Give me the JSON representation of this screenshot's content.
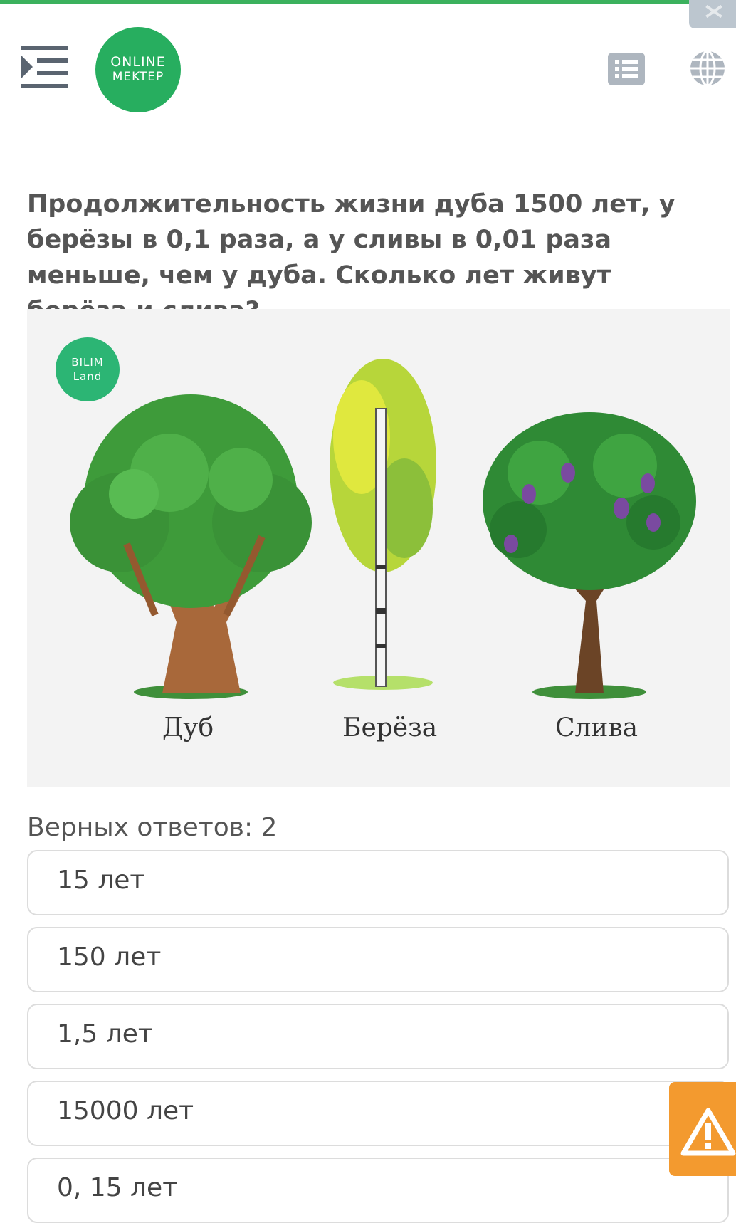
{
  "header": {
    "logo_line1": "ONLINE",
    "logo_line2": "MEKTEP"
  },
  "question": "Продолжительность жизни дуба 1500 лет, у берёзы в 0,1 раза, а у сливы в 0,01 раза меньше, чем у дуба. Сколько лет живут берёза и слива?",
  "picture": {
    "badge_line1": "BILIM",
    "badge_line2": "Land",
    "labels": [
      "Дуб",
      "Берёза",
      "Слива"
    ]
  },
  "answers_count": "Верных ответов: 2",
  "options": [
    "15 лет",
    "150 лет",
    "1,5 лет",
    "15000 лет",
    "0, 15 лет"
  ],
  "colors": {
    "accent": "#3bb15d",
    "logo": "#27ae5f",
    "warning": "#f39a2f"
  },
  "icons": [
    "menu-collapse-icon",
    "list-icon",
    "globe-icon",
    "close-icon",
    "warning-icon"
  ]
}
